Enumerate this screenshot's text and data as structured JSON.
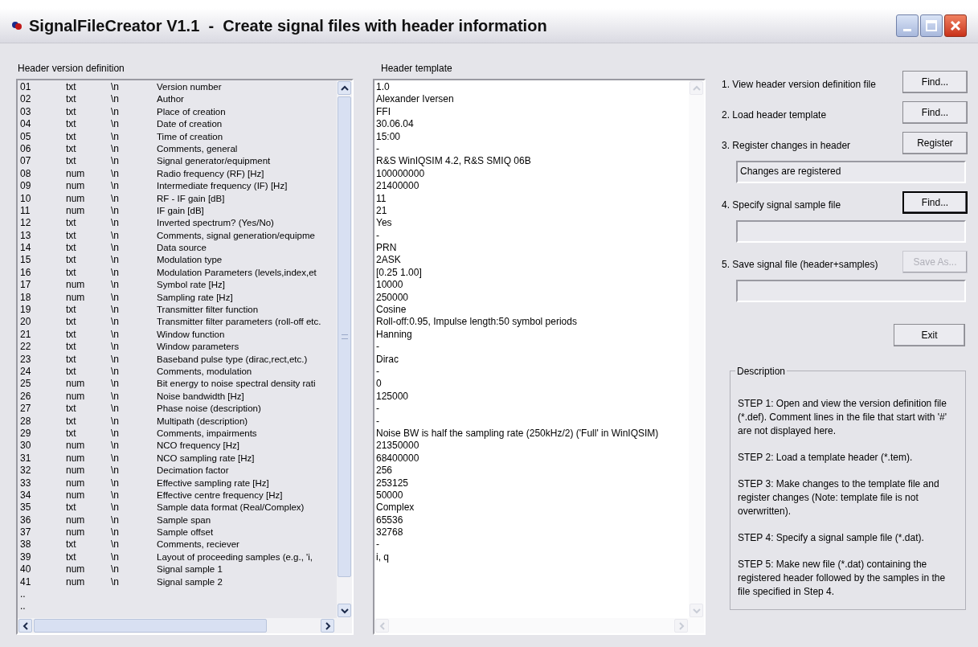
{
  "window": {
    "title": "SignalFileCreator V1.1  -  Create signal files with header information"
  },
  "definition": {
    "label": "Header version definition",
    "rows": [
      {
        "number": "01",
        "type": "txt",
        "terminator": "\\n",
        "description": "Version number"
      },
      {
        "number": "02",
        "type": "txt",
        "terminator": "\\n",
        "description": "Author"
      },
      {
        "number": "03",
        "type": "txt",
        "terminator": "\\n",
        "description": "Place of creation"
      },
      {
        "number": "04",
        "type": "txt",
        "terminator": "\\n",
        "description": "Date of creation"
      },
      {
        "number": "05",
        "type": "txt",
        "terminator": "\\n",
        "description": "Time of creation"
      },
      {
        "number": "06",
        "type": "txt",
        "terminator": "\\n",
        "description": "Comments, general"
      },
      {
        "number": "07",
        "type": "txt",
        "terminator": "\\n",
        "description": "Signal generator/equipment"
      },
      {
        "number": "08",
        "type": "num",
        "terminator": "\\n",
        "description": "Radio frequency (RF) [Hz]"
      },
      {
        "number": "09",
        "type": "num",
        "terminator": "\\n",
        "description": "Intermediate frequency (IF) [Hz]"
      },
      {
        "number": "10",
        "type": "num",
        "terminator": "\\n",
        "description": "RF - IF gain [dB]"
      },
      {
        "number": "11",
        "type": "num",
        "terminator": "\\n",
        "description": "IF gain [dB]"
      },
      {
        "number": "12",
        "type": "txt",
        "terminator": "\\n",
        "description": "Inverted spectrum? (Yes/No)"
      },
      {
        "number": "13",
        "type": "txt",
        "terminator": "\\n",
        "description": "Comments, signal generation/equipme"
      },
      {
        "number": "14",
        "type": "txt",
        "terminator": "\\n",
        "description": "Data source"
      },
      {
        "number": "15",
        "type": "txt",
        "terminator": "\\n",
        "description": "Modulation type"
      },
      {
        "number": "16",
        "type": "txt",
        "terminator": "\\n",
        "description": "Modulation Parameters (levels,index,et"
      },
      {
        "number": "17",
        "type": "num",
        "terminator": "\\n",
        "description": "Symbol rate [Hz]"
      },
      {
        "number": "18",
        "type": "num",
        "terminator": "\\n",
        "description": "Sampling rate [Hz]"
      },
      {
        "number": "19",
        "type": "txt",
        "terminator": "\\n",
        "description": "Transmitter filter function"
      },
      {
        "number": "20",
        "type": "txt",
        "terminator": "\\n",
        "description": "Transmitter filter parameters (roll-off etc."
      },
      {
        "number": "21",
        "type": "txt",
        "terminator": "\\n",
        "description": "Window function"
      },
      {
        "number": "22",
        "type": "txt",
        "terminator": "\\n",
        "description": "Window parameters"
      },
      {
        "number": "23",
        "type": "txt",
        "terminator": "\\n",
        "description": "Baseband pulse type (dirac,rect,etc.)"
      },
      {
        "number": "24",
        "type": "txt",
        "terminator": "\\n",
        "description": "Comments, modulation"
      },
      {
        "number": "25",
        "type": "num",
        "terminator": "\\n",
        "description": "Bit energy to noise spectral density rati"
      },
      {
        "number": "26",
        "type": "num",
        "terminator": "\\n",
        "description": "Noise bandwidth [Hz]"
      },
      {
        "number": "27",
        "type": "txt",
        "terminator": "\\n",
        "description": "Phase noise (description)"
      },
      {
        "number": "28",
        "type": "txt",
        "terminator": "\\n",
        "description": "Multipath (description)"
      },
      {
        "number": "29",
        "type": "txt",
        "terminator": "\\n",
        "description": "Comments, impairments"
      },
      {
        "number": "30",
        "type": "num",
        "terminator": "\\n",
        "description": "NCO frequency [Hz]"
      },
      {
        "number": "31",
        "type": "num",
        "terminator": "\\n",
        "description": "NCO sampling rate [Hz]"
      },
      {
        "number": "32",
        "type": "num",
        "terminator": "\\n",
        "description": "Decimation factor"
      },
      {
        "number": "33",
        "type": "num",
        "terminator": "\\n",
        "description": "Effective sampling rate [Hz]"
      },
      {
        "number": "34",
        "type": "num",
        "terminator": "\\n",
        "description": "Effective centre frequency [Hz]"
      },
      {
        "number": "35",
        "type": "txt",
        "terminator": "\\n",
        "description": "Sample data format (Real/Complex)"
      },
      {
        "number": "36",
        "type": "num",
        "terminator": "\\n",
        "description": "Sample span"
      },
      {
        "number": "37",
        "type": "num",
        "terminator": "\\n",
        "description": "Sample offset"
      },
      {
        "number": "38",
        "type": "txt",
        "terminator": "\\n",
        "description": "Comments, reciever"
      },
      {
        "number": "39",
        "type": "txt",
        "terminator": "\\n",
        "description": "Layout of proceeding samples (e.g., 'i,"
      },
      {
        "number": "40",
        "type": "num",
        "terminator": "\\n",
        "description": "Signal sample 1"
      },
      {
        "number": "41",
        "type": "num",
        "terminator": "\\n",
        "description": "Signal sample 2"
      }
    ],
    "trailing": [
      "..",
      ".."
    ]
  },
  "template": {
    "label": "Header template",
    "lines": [
      "1.0",
      "Alexander Iversen",
      "FFI",
      "30.06.04",
      "15:00",
      "-",
      "R&S WinIQSIM 4.2, R&S SMIQ 06B",
      "100000000",
      "21400000",
      "11",
      "21",
      "Yes",
      "-",
      "PRN",
      "2ASK",
      "[0.25 1.00]",
      "10000",
      "250000",
      "Cosine",
      "Roll-off:0.95, Impulse length:50 symbol periods",
      "Hanning",
      "-",
      "Dirac",
      "-",
      "0",
      "125000",
      "-",
      "-",
      "Noise BW is half the sampling rate (250kHz/2) ('Full' in WinIQSIM)",
      "21350000",
      "68400000",
      "256",
      "253125",
      "50000",
      "Complex",
      "65536",
      "32768",
      "-",
      "i, q"
    ]
  },
  "steps": [
    {
      "kind": "plain",
      "label": "1. View header version definition file",
      "button": {
        "label": "Find...",
        "disabled": false,
        "focused": false
      }
    },
    {
      "kind": "plain",
      "label": "2. Load header template",
      "button": {
        "label": "Find...",
        "disabled": false,
        "focused": false
      }
    },
    {
      "kind": "with_field",
      "label": "3. Register changes in  header",
      "button": {
        "label": "Register",
        "disabled": false,
        "focused": false
      },
      "field": {
        "value": "Changes are registered"
      }
    },
    {
      "kind": "with_field",
      "label": "4. Specify signal sample file",
      "button": {
        "label": "Find...",
        "disabled": false,
        "focused": true
      }
    },
    {
      "kind": "with_field",
      "label": "5. Save signal file (header+samples)",
      "button": {
        "label": "Save As...",
        "disabled": true,
        "focused": false
      }
    }
  ],
  "exit_button": {
    "label": "Exit"
  },
  "description": {
    "title": "Description",
    "paragraphs": [
      "STEP 1: Open and view the version definition file (*.def). Comment lines in the file that start with '#' are not displayed here.",
      "STEP 2: Load a template header (*.tem).",
      "STEP 3: Make changes to the template file and register changes (Note: template file is not overwritten).",
      "STEP 4: Specify a signal sample file (*.dat).",
      "STEP 5: Make new file (*.dat) containing the registered header followed by the samples in the file specified in Step 4."
    ]
  }
}
